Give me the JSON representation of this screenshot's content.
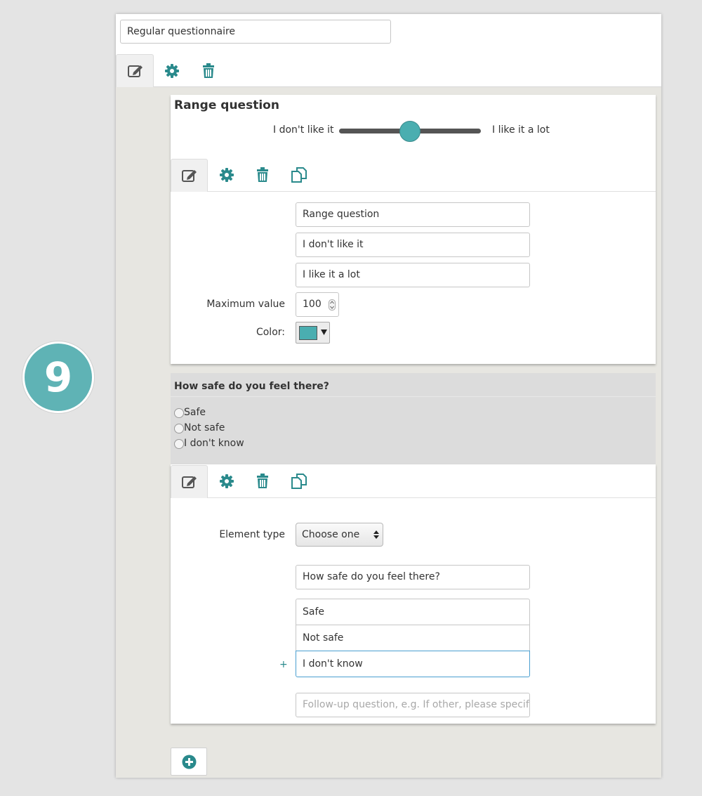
{
  "questionnaire": {
    "title_value": "Regular questionnaire"
  },
  "colors": {
    "accent": "#2a8a8c",
    "slider_thumb": "#4aaeb0",
    "swatch": "#4aaeb0"
  },
  "range_question": {
    "title": "Range question",
    "min_label": "I don't like it",
    "max_label": "I like it a lot",
    "slider_level_percent": 50,
    "editor": {
      "title_value": "Range question",
      "min_label_value": "I don't like it",
      "max_label_value": "I like it a lot",
      "max_value_label": "Maximum value",
      "max_value": "100",
      "color_label": "Color:"
    }
  },
  "choice_question": {
    "title": "How safe do you feel there?",
    "options": [
      "Safe",
      "Not safe",
      "I don't know"
    ],
    "editor": {
      "element_type_label": "Element type",
      "element_type_value": "Choose one",
      "question_value": "How safe do you feel there?",
      "option_values": [
        "Safe",
        "Not safe",
        "I don't know"
      ],
      "add_symbol": "+",
      "followup_placeholder": "Follow-up question, e.g. If other, please specify"
    }
  },
  "step_number": "9"
}
